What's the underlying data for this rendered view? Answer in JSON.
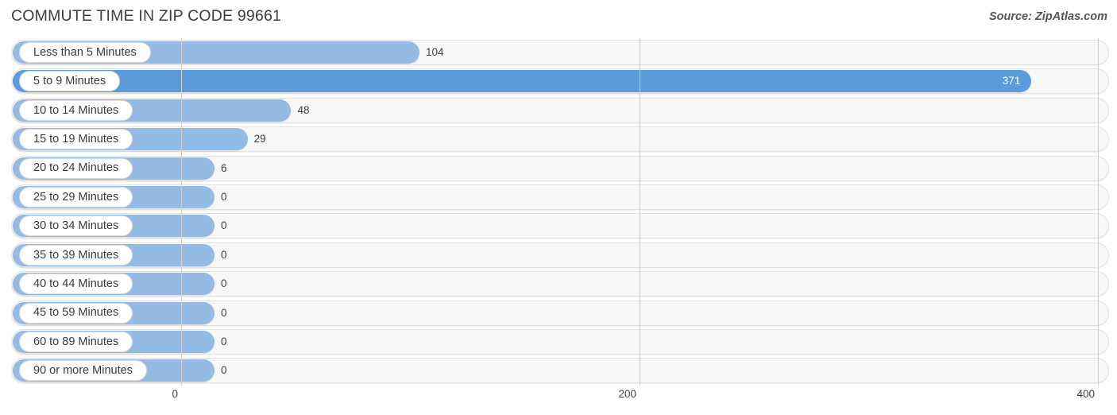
{
  "header": {
    "title": "COMMUTE TIME IN ZIP CODE 99661",
    "source": "Source: ZipAtlas.com"
  },
  "colors": {
    "bar_light": "#94bbe4",
    "bar_max": "#5b9bd9",
    "track_bg": "#f7f7f7",
    "track_border": "#e2e2e2",
    "gridline": "#d0d0d0",
    "text": "#3b3b3b",
    "value_inside": "#ffffff"
  },
  "chart_data": {
    "type": "bar",
    "orientation": "horizontal",
    "title": "COMMUTE TIME IN ZIP CODE 99661",
    "xlabel": "",
    "ylabel": "",
    "xlim": [
      0,
      400
    ],
    "grid": true,
    "legend": false,
    "xticks": [
      "0",
      "200",
      "400"
    ],
    "xtick_values": [
      0,
      200,
      400
    ],
    "categories": [
      "Less than 5 Minutes",
      "5 to 9 Minutes",
      "10 to 14 Minutes",
      "15 to 19 Minutes",
      "20 to 24 Minutes",
      "25 to 29 Minutes",
      "30 to 34 Minutes",
      "35 to 39 Minutes",
      "40 to 44 Minutes",
      "45 to 59 Minutes",
      "60 to 89 Minutes",
      "90 or more Minutes"
    ],
    "values": [
      104,
      371,
      48,
      29,
      6,
      0,
      0,
      0,
      0,
      0,
      0,
      0
    ],
    "value_labels": [
      "104",
      "371",
      "48",
      "29",
      "6",
      "0",
      "0",
      "0",
      "0",
      "0",
      "0",
      "0"
    ],
    "max_value": 371,
    "max_index": 1
  }
}
